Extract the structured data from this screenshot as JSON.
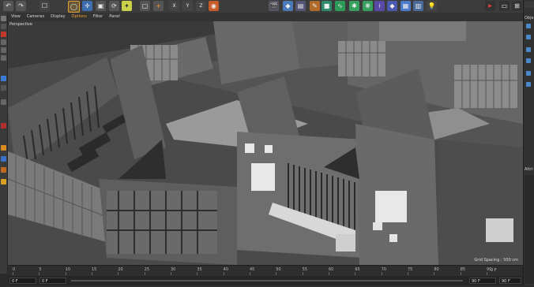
{
  "menu": {
    "items": [
      "View",
      "Cameras",
      "Display",
      "Options",
      "Filter",
      "Panel"
    ],
    "active_index": 3
  },
  "viewport": {
    "label": "Perspective",
    "grid_spacing": "Grid Spacing : 500 cm"
  },
  "timeline": {
    "ticks": [
      "0",
      "5",
      "10",
      "15",
      "20",
      "25",
      "30",
      "35",
      "40",
      "45",
      "50",
      "55",
      "60",
      "65",
      "70",
      "75",
      "80",
      "85",
      "90"
    ],
    "start_field": "0 F",
    "current_field": "0 F",
    "end_field": "90 F",
    "end_field2": "90 F",
    "frame_readout": "0 F"
  },
  "right_panel": {
    "label_top": "Obje",
    "label_mid": "Attri"
  },
  "toolbar": {
    "icons": [
      "cube-icon",
      "move-icon",
      "scale-icon",
      "rotate-icon",
      "render-icon",
      "x-axis-icon",
      "y-axis-icon",
      "z-axis-icon",
      "world-icon",
      "camera-icon",
      "light-icon",
      "cube-primitive-icon",
      "spline-icon",
      "nurbs-icon",
      "deformer-icon",
      "mograph-icon",
      "character-icon",
      "scene-icon",
      "floor-icon",
      "bulb-icon",
      "clapboard-icon",
      "play-icon"
    ]
  }
}
